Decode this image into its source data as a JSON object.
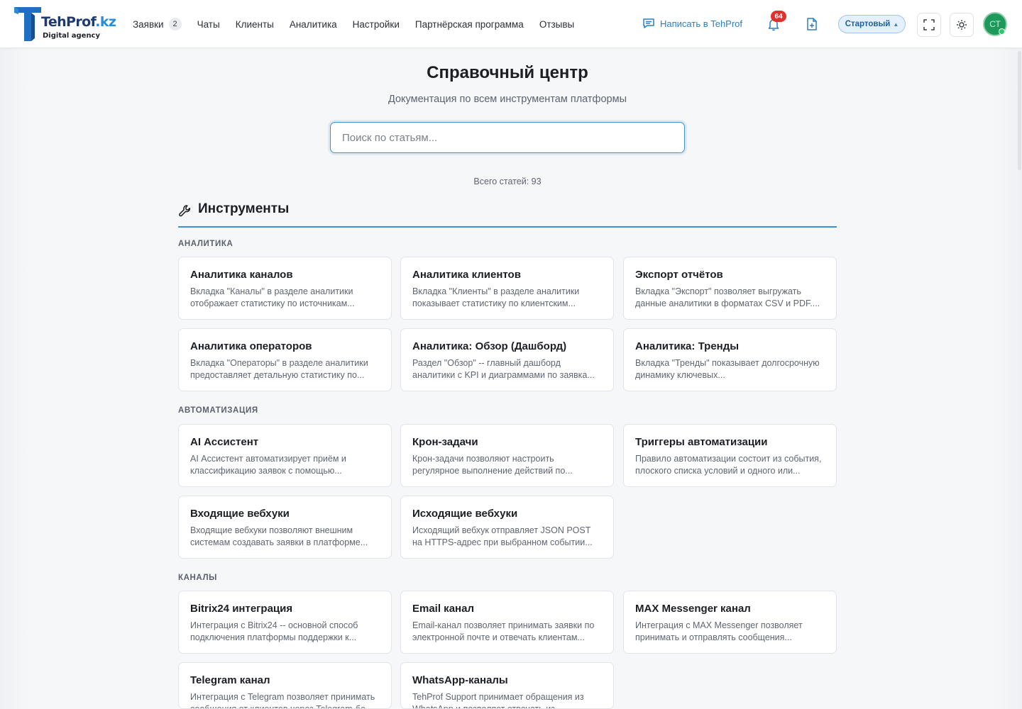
{
  "header": {
    "logo": {
      "name": "TehProf",
      "tld": ".kz",
      "tagline": "Digital agency"
    },
    "nav": [
      {
        "label": "Заявки",
        "badge": "2"
      },
      {
        "label": "Чаты"
      },
      {
        "label": "Клиенты"
      },
      {
        "label": "Аналитика"
      },
      {
        "label": "Настройки"
      },
      {
        "label": "Партнёрская программа"
      },
      {
        "label": "Отзывы"
      }
    ],
    "write_label": "Написать в TehProf",
    "notifications_count": "64",
    "plan_label": "Стартовый",
    "avatar_initials": "СТ",
    "icons": [
      "chat-bubble-icon",
      "bell-icon",
      "file-plus-icon",
      "chevron-up-icon",
      "fullscreen-icon",
      "sun-icon"
    ]
  },
  "hero": {
    "title": "Справочный центр",
    "subtitle": "Документация по всем инструментам платформы",
    "search_placeholder": "Поиск по статьям...",
    "search_value": "",
    "total": "Всего статей: 93"
  },
  "section": {
    "title": "Инструменты",
    "icon": "wrench-icon",
    "accent_color": "#3f8fcf",
    "categories": [
      {
        "label": "АНАЛИТИКА",
        "cards": [
          {
            "title": "Аналитика каналов",
            "desc": "Вкладка \"Каналы\" в разделе аналитики отображает статистику по источникам..."
          },
          {
            "title": "Аналитика клиентов",
            "desc": "Вкладка \"Клиенты\" в разделе аналитики показывает статистику по клиентским..."
          },
          {
            "title": "Экспорт отчётов",
            "desc": "Вкладка \"Экспорт\" позволяет выгружать данные аналитики в форматах CSV и PDF...."
          },
          {
            "title": "Аналитика операторов",
            "desc": "Вкладка \"Операторы\" в разделе аналитики предоставляет детальную статистику по..."
          },
          {
            "title": "Аналитика: Обзор (Дашборд)",
            "desc": "Раздел \"Обзор\" -- главный дашборд аналитики с KPI и диаграммами по заявка..."
          },
          {
            "title": "Аналитика: Тренды",
            "desc": "Вкладка \"Тренды\" показывает долгосрочную динамику ключевых..."
          }
        ]
      },
      {
        "label": "АВТОМАТИЗАЦИЯ",
        "cards": [
          {
            "title": "AI Ассистент",
            "desc": "AI Ассистент автоматизирует приём и классификацию заявок с помощью..."
          },
          {
            "title": "Крон-задачи",
            "desc": "Крон-задачи позволяют настроить регулярное выполнение действий по..."
          },
          {
            "title": "Триггеры автоматизации",
            "desc": "Правило автоматизации состоит из события, плоского списка условий и одного или..."
          },
          {
            "title": "Входящие вебхуки",
            "desc": "Входящие вебхуки позволяют внешним системам создавать заявки в платформе..."
          },
          {
            "title": "Исходящие вебхуки",
            "desc": "Исходящий вебхук отправляет JSON POST на HTTPS-адрес при выбранном событии..."
          }
        ]
      },
      {
        "label": "КАНАЛЫ",
        "cards": [
          {
            "title": "Bitrix24 интеграция",
            "desc": "Интеграция с Bitrix24 -- основной способ подключения платформы поддержки к..."
          },
          {
            "title": "Email канал",
            "desc": "Email-канал позволяет принимать заявки по электронной почте и отвечать клиентам..."
          },
          {
            "title": "MAX Messenger канал",
            "desc": "Интеграция с MAX Messenger позволяет принимать и отправлять сообщения..."
          },
          {
            "title": "Telegram канал",
            "desc": "Интеграция с Telegram позволяет принимать сообщения от клиентов через Telegram-бо..."
          },
          {
            "title": "WhatsApp-каналы",
            "desc": "TehProf Support принимает обращения из WhatsApp и позволяет отвечать из..."
          }
        ]
      }
    ]
  }
}
